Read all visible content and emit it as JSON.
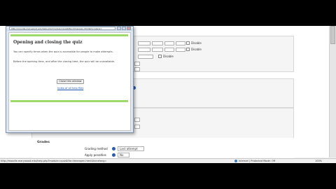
{
  "popup": {
    "url": "http://moodle.marywood.edu/help.php?module=quiz&file=timeopen.html&forcelang=",
    "title": "Opening and closing the quiz",
    "para1": "You can specify times when the quiz is accessible for people to make attempts.",
    "para2": "Before the opening time, and after the closing time, the quiz will be unavailable.",
    "close_button": "Close this window",
    "help_link": "Index of all help files"
  },
  "form": {
    "disable_label_1": "Disable",
    "disable_label_2": "Disable",
    "disable_label_3": "Disable",
    "grades_section": "Grades",
    "grading_method_label": "Grading method",
    "grading_method_value": "Last attempt",
    "apply_penalties_label": "Apply penalties",
    "apply_penalties_value": "No"
  },
  "statusbar": {
    "url": "http://moodle.marywood.edu/help.php?module=quiz&file=timeopen.html&forcelang=",
    "zone": "Internet | Protected Mode: Off",
    "zoom": "100%"
  }
}
